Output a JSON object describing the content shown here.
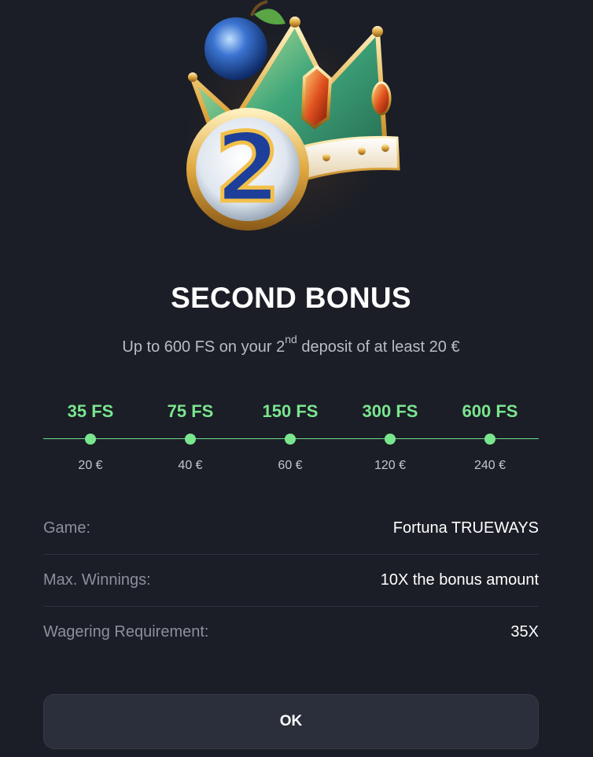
{
  "bonus": {
    "title": "SECOND BONUS",
    "subtitle_prefix": "Up to 600 FS on your 2",
    "subtitle_sup": "nd",
    "subtitle_suffix": " deposit of at least 20 €",
    "hero_image": "crown-with-number-2-and-plum"
  },
  "tiers": [
    {
      "fs": "35 FS",
      "amount": "20 €"
    },
    {
      "fs": "75 FS",
      "amount": "40 €"
    },
    {
      "fs": "150 FS",
      "amount": "60 €"
    },
    {
      "fs": "300 FS",
      "amount": "120 €"
    },
    {
      "fs": "600 FS",
      "amount": "240 €"
    }
  ],
  "details": [
    {
      "label": "Game:",
      "value": "Fortuna TRUEWAYS"
    },
    {
      "label": "Max. Winnings:",
      "value": "10X the bonus amount"
    },
    {
      "label": "Wagering Requirement:",
      "value": "35X"
    }
  ],
  "ok_button": {
    "label": "OK"
  },
  "colors": {
    "background": "#1b1e26",
    "accent_green": "#7ae58f",
    "button_bg": "#2a2f3b",
    "label_gray": "#8c909b"
  }
}
